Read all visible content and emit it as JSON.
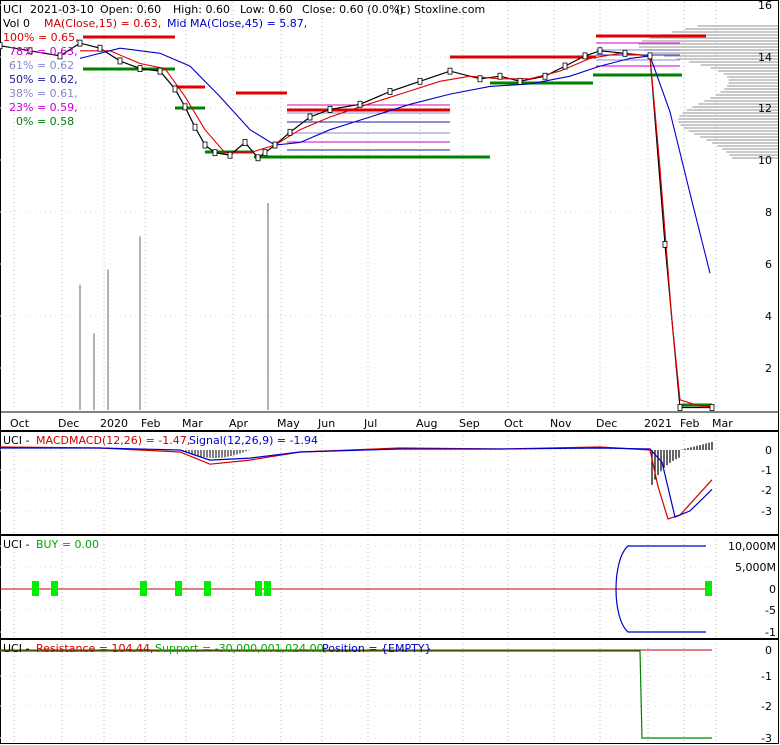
{
  "chart_data": [
    {
      "type": "line",
      "panel": "price",
      "header": {
        "symbol": "UCI",
        "date": "2021-03-10",
        "open_label": "Open: 0.60",
        "high_label": "High: 0.60",
        "low_label": "Low: 0.60",
        "close_label": "Close: 0.60 (0.0%)",
        "copyright": "(c) Stoxline.com",
        "vol_label": "Vol 0",
        "ma15_label": "MA(Close,15) = 0.63,",
        "ma45_label": "Mid MA(Close,45) = 5.87,"
      },
      "fib_levels": [
        {
          "label": "100% = 0.65,",
          "color": "#e00000"
        },
        {
          "label": "78% = 0.63,",
          "color": "#cc00cc"
        },
        {
          "label": "61% = 0.62",
          "color": "#8888cc"
        },
        {
          "label": "50% = 0.62,",
          "color": "#2020a0"
        },
        {
          "label": "38% = 0.61,",
          "color": "#8888cc"
        },
        {
          "label": "23% = 0.59,",
          "color": "#cc00cc"
        },
        {
          "label": "0% = 0.58",
          "color": "#008000"
        }
      ],
      "months": [
        "Oct",
        "Dec",
        "2020",
        "Feb",
        "Mar",
        "Apr",
        "May",
        "Jun",
        "Jul",
        "Aug",
        "Sep",
        "Oct",
        "Nov",
        "Dec",
        "2021",
        "Feb",
        "Mar"
      ],
      "y_ticks": [
        "16",
        "14",
        "12",
        "10",
        "8",
        "6",
        "4",
        "2"
      ],
      "ylim": [
        0.5,
        16.2
      ],
      "series": [
        {
          "name": "Close",
          "color": "#000000",
          "points": [
            [
              0,
              14.8
            ],
            [
              30,
              14.6
            ],
            [
              60,
              14.4
            ],
            [
              80,
              14.9
            ],
            [
              100,
              14.7
            ],
            [
              120,
              14.2
            ],
            [
              140,
              13.9
            ],
            [
              160,
              13.8
            ],
            [
              175,
              13.1
            ],
            [
              185,
              12.4
            ],
            [
              195,
              11.6
            ],
            [
              205,
              10.9
            ],
            [
              215,
              10.6
            ],
            [
              230,
              10.5
            ],
            [
              245,
              11.0
            ],
            [
              258,
              10.4
            ],
            [
              265,
              10.6
            ],
            [
              275,
              10.9
            ],
            [
              290,
              11.4
            ],
            [
              310,
              12.0
            ],
            [
              330,
              12.3
            ],
            [
              360,
              12.5
            ],
            [
              390,
              13.0
            ],
            [
              420,
              13.4
            ],
            [
              450,
              13.8
            ],
            [
              480,
              13.5
            ],
            [
              500,
              13.6
            ],
            [
              520,
              13.4
            ],
            [
              545,
              13.6
            ],
            [
              565,
              14.0
            ],
            [
              585,
              14.4
            ],
            [
              600,
              14.6
            ],
            [
              625,
              14.5
            ],
            [
              650,
              14.4
            ],
            [
              665,
              7.0
            ],
            [
              680,
              0.6
            ],
            [
              712,
              0.6
            ]
          ]
        },
        {
          "name": "MA(Close,15)",
          "color": "#e00000",
          "points": [
            [
              80,
              14.6
            ],
            [
              110,
              14.6
            ],
            [
              140,
              14.1
            ],
            [
              165,
              13.9
            ],
            [
              185,
              12.8
            ],
            [
              205,
              11.5
            ],
            [
              225,
              10.6
            ],
            [
              250,
              10.6
            ],
            [
              275,
              10.9
            ],
            [
              300,
              11.5
            ],
            [
              330,
              12.0
            ],
            [
              360,
              12.4
            ],
            [
              400,
              12.9
            ],
            [
              440,
              13.4
            ],
            [
              470,
              13.6
            ],
            [
              500,
              13.5
            ],
            [
              530,
              13.5
            ],
            [
              560,
              13.8
            ],
            [
              590,
              14.3
            ],
            [
              620,
              14.5
            ],
            [
              650,
              14.4
            ],
            [
              660,
              10.0
            ],
            [
              672,
              4.0
            ],
            [
              680,
              0.9
            ],
            [
              700,
              0.65
            ],
            [
              712,
              0.63
            ]
          ]
        },
        {
          "name": "Mid MA(Close,45)",
          "color": "#0000cc",
          "points": [
            [
              80,
              14.3
            ],
            [
              120,
              14.7
            ],
            [
              160,
              14.5
            ],
            [
              190,
              14.0
            ],
            [
              220,
              12.8
            ],
            [
              250,
              11.5
            ],
            [
              275,
              10.9
            ],
            [
              300,
              11.0
            ],
            [
              330,
              11.5
            ],
            [
              370,
              12.0
            ],
            [
              410,
              12.5
            ],
            [
              450,
              12.9
            ],
            [
              490,
              13.2
            ],
            [
              530,
              13.3
            ],
            [
              570,
              13.6
            ],
            [
              600,
              14.0
            ],
            [
              630,
              14.3
            ],
            [
              650,
              14.4
            ],
            [
              670,
              12.2
            ],
            [
              690,
              9.0
            ],
            [
              710,
              5.87
            ]
          ]
        }
      ],
      "volume_spikes": [
        {
          "x": 80,
          "value": 4900000
        },
        {
          "x": 94,
          "value": 3000000
        },
        {
          "x": 108,
          "value": 5500000
        },
        {
          "x": 140,
          "value": 6800000
        },
        {
          "x": 268,
          "value": 8100000
        }
      ],
      "volume_max_units": 9000000
    },
    {
      "type": "line",
      "panel": "macd",
      "title_prefix": "UCI - ",
      "macd_label": "MACDMACD(12,26) = -1.47,",
      "signal_label": "Signal(12,26,9) = -1.94",
      "y_ticks": [
        "0",
        "-1",
        "-2",
        "-3"
      ],
      "ylim": [
        -3.9,
        0.4
      ],
      "series": [
        {
          "name": "MACD",
          "color": "#cc0000",
          "points": [
            [
              0,
              0.15
            ],
            [
              100,
              0.1
            ],
            [
              180,
              -0.1
            ],
            [
              210,
              -0.7
            ],
            [
              250,
              -0.5
            ],
            [
              300,
              -0.1
            ],
            [
              400,
              0.1
            ],
            [
              500,
              0.05
            ],
            [
              600,
              0.15
            ],
            [
              650,
              0.0
            ],
            [
              658,
              -1.8
            ],
            [
              668,
              -3.4
            ],
            [
              680,
              -3.2
            ],
            [
              712,
              -1.47
            ]
          ]
        },
        {
          "name": "Signal",
          "color": "#0000cc",
          "points": [
            [
              0,
              0.1
            ],
            [
              100,
              0.1
            ],
            [
              180,
              0.0
            ],
            [
              210,
              -0.5
            ],
            [
              250,
              -0.4
            ],
            [
              300,
              -0.1
            ],
            [
              400,
              0.05
            ],
            [
              500,
              0.05
            ],
            [
              600,
              0.1
            ],
            [
              650,
              0.05
            ],
            [
              662,
              -0.6
            ],
            [
              675,
              -3.3
            ],
            [
              690,
              -3.0
            ],
            [
              712,
              -1.94
            ]
          ]
        }
      ]
    },
    {
      "type": "line",
      "panel": "buy",
      "title_prefix": "UCI - ",
      "buy_label": "BUY = 0.00",
      "y_ticks": [
        "10,000M",
        "5,000M",
        "0",
        "-5",
        "-1"
      ],
      "buy_markers_x": [
        35,
        54,
        143,
        178,
        207,
        258,
        267,
        708
      ]
    },
    {
      "type": "line",
      "panel": "resistance",
      "title_prefix": "UCI - ",
      "resistance_label": "Resistance = 104.44,",
      "support_label": "Support = -30,000,001,024.00,",
      "position_label": "Position = {EMPTY}",
      "y_ticks": [
        "0",
        "-1",
        "-2",
        "-3"
      ]
    }
  ]
}
